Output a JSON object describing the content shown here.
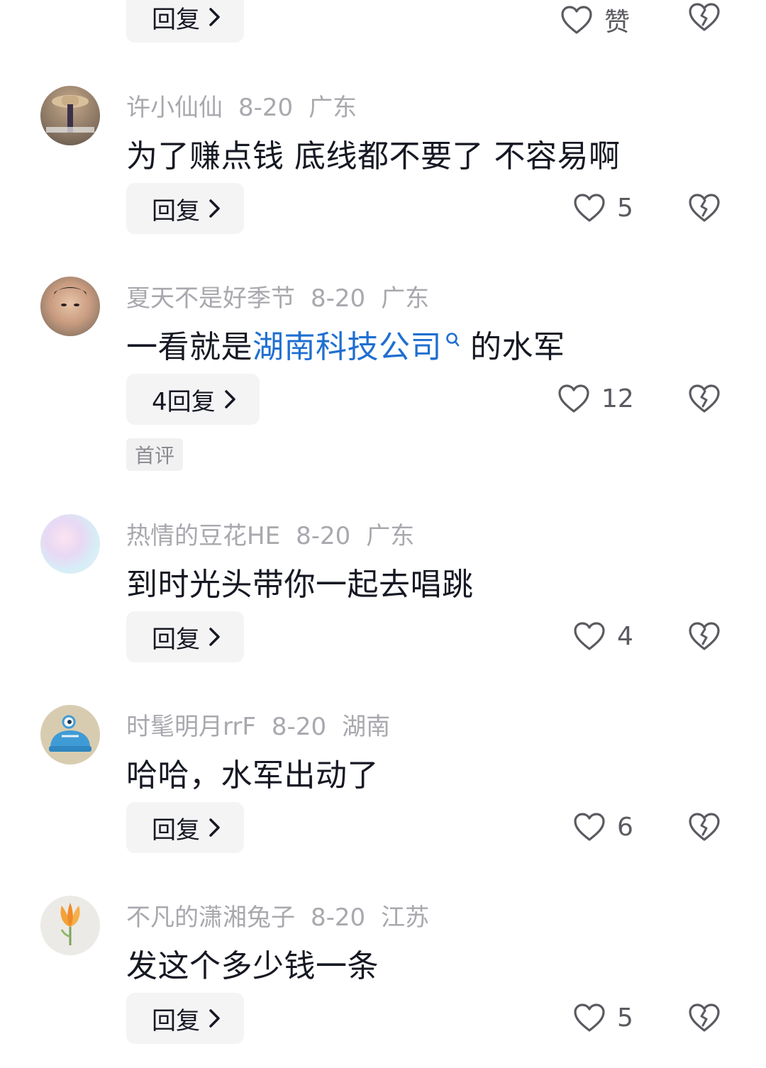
{
  "top": {
    "reply_label": "回复",
    "like_label": "赞"
  },
  "comments": [
    {
      "username": "许小仙仙",
      "date": "8-20",
      "location": "广东",
      "text": "为了赚点钱 底线都不要了 不容易啊",
      "reply_label": "回复",
      "likes": "5"
    },
    {
      "username": "夏天不是好季节",
      "date": "8-20",
      "location": "广东",
      "text_before": "一看就是",
      "text_link": "湖南科技公司",
      "text_after": "的水军",
      "reply_label": "4回复",
      "likes": "12",
      "tag": "首评"
    },
    {
      "username": "热情的豆花HE",
      "date": "8-20",
      "location": "广东",
      "text": "到时光头带你一起去唱跳",
      "reply_label": "回复",
      "likes": "4"
    },
    {
      "username": "时髦明月rrF",
      "date": "8-20",
      "location": "湖南",
      "text": "哈哈，水军出动了",
      "reply_label": "回复",
      "likes": "6"
    },
    {
      "username": "不凡的潇湘兔子",
      "date": "8-20",
      "location": "江苏",
      "text": "发这个多少钱一条",
      "reply_label": "回复",
      "likes": "5"
    }
  ],
  "colors": {
    "link": "#1f6fd1",
    "meta": "#a8a8ae",
    "text": "#161823",
    "button_bg": "#f4f4f5"
  }
}
